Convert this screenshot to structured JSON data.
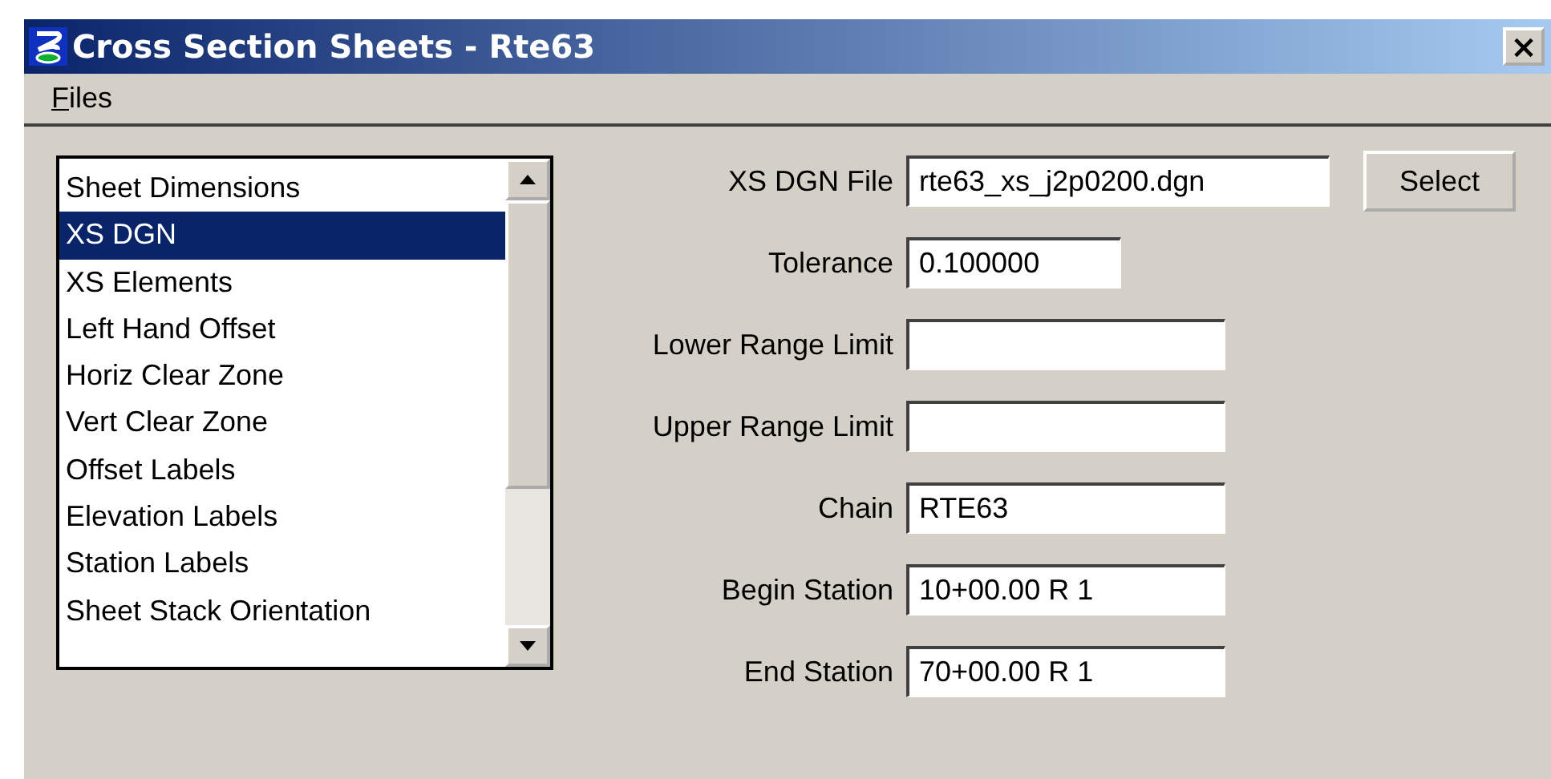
{
  "window": {
    "title": "Cross Section Sheets - Rte63",
    "close": "×"
  },
  "menu": [
    {
      "label": "Files"
    }
  ],
  "list": {
    "items": [
      {
        "label": "Sheet Dimensions",
        "selected": false
      },
      {
        "label": "XS DGN",
        "selected": true
      },
      {
        "label": "XS Elements",
        "selected": false
      },
      {
        "label": "Left Hand Offset",
        "selected": false
      },
      {
        "label": "Horiz Clear Zone",
        "selected": false
      },
      {
        "label": "Vert Clear Zone",
        "selected": false
      },
      {
        "label": "Offset Labels",
        "selected": false
      },
      {
        "label": "Elevation Labels",
        "selected": false
      },
      {
        "label": "Station Labels",
        "selected": false
      },
      {
        "label": "Sheet Stack Orientation",
        "selected": false
      }
    ]
  },
  "fields": [
    {
      "label": "XS DGN File",
      "value": "rte63_xs_j2p0200.dgn",
      "kind": "file",
      "button": "Select"
    },
    {
      "label": "Tolerance",
      "value": "0.100000",
      "kind": "number"
    },
    {
      "label": "Lower Range Limit",
      "kind": "text"
    },
    {
      "label": "Upper Range Limit",
      "kind": "text"
    },
    {
      "label": "Chain",
      "value": "RTE63",
      "kind": "text"
    },
    {
      "label": "Begin Station",
      "value": "10+00.00 R 1",
      "kind": "text"
    },
    {
      "label": "End Station",
      "value": "70+00.00 R 1",
      "kind": "text"
    }
  ]
}
